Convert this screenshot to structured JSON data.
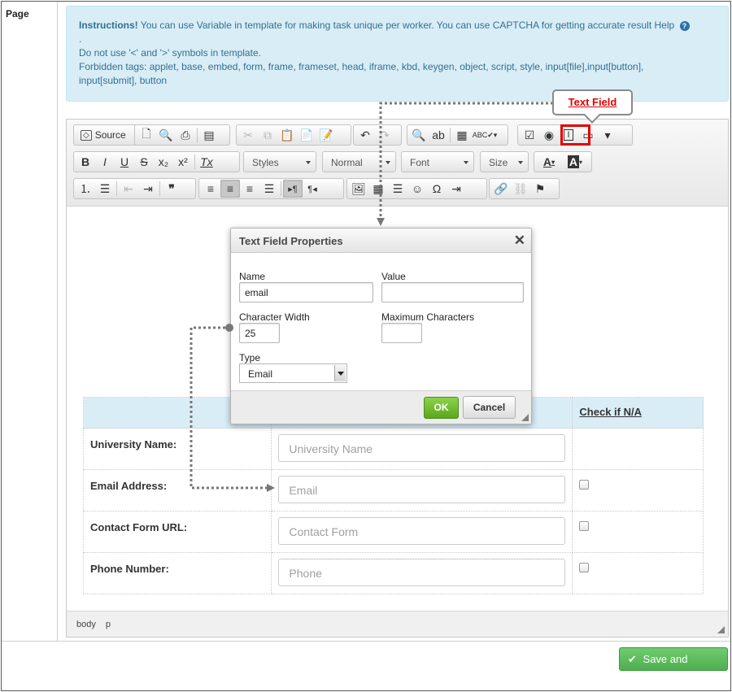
{
  "page": {
    "label": "Page"
  },
  "instructions": {
    "title": "Instructions!",
    "text1": "You can use Variable in template for making task unique per worker. You can use CAPTCHA for getting accurate result",
    "help": "Help",
    "help_icon": "question-circle-icon",
    "dot": ".",
    "line2": "Do not use '<' and '>' symbols in template.",
    "line3": "Forbidden tags: applet, base, embed, form, frame, frameset, head, iframe, kbd, keygen, object, script, style, input[file],input[button],",
    "line4": "input[submit], button"
  },
  "toolbar": {
    "source_label": "Source",
    "styles_label": "Styles",
    "format_label": "Normal",
    "font_label": "Font",
    "size_label": "Size",
    "text_color_label": "A",
    "bg_color_label": "A"
  },
  "callout": {
    "label": "Text Field",
    "color": "#e00000"
  },
  "dialog": {
    "title": "Text Field Properties",
    "close": "✕",
    "name_label": "Name",
    "name_value": "email",
    "value_label": "Value",
    "value_value": "",
    "charwidth_label": "Character Width",
    "charwidth_value": "25",
    "maxchars_label": "Maximum Characters",
    "maxchars_value": "",
    "type_label": "Type",
    "type_value": "Email",
    "ok": "OK",
    "cancel": "Cancel"
  },
  "form_table": {
    "na_header": "Check if N/A",
    "rows": [
      {
        "label": "University Name:",
        "placeholder": "University Name",
        "has_check": false
      },
      {
        "label": "Email Address:",
        "placeholder": "Email",
        "has_check": true
      },
      {
        "label": "Contact Form URL:",
        "placeholder": "Contact Form",
        "has_check": true
      },
      {
        "label": "Phone Number:",
        "placeholder": "Phone",
        "has_check": true
      }
    ]
  },
  "statusbar": {
    "path1": "body",
    "path2": "p"
  },
  "save_button": {
    "label": "Save and Preview",
    "icon": "check-icon",
    "color": "#5cb85c"
  }
}
